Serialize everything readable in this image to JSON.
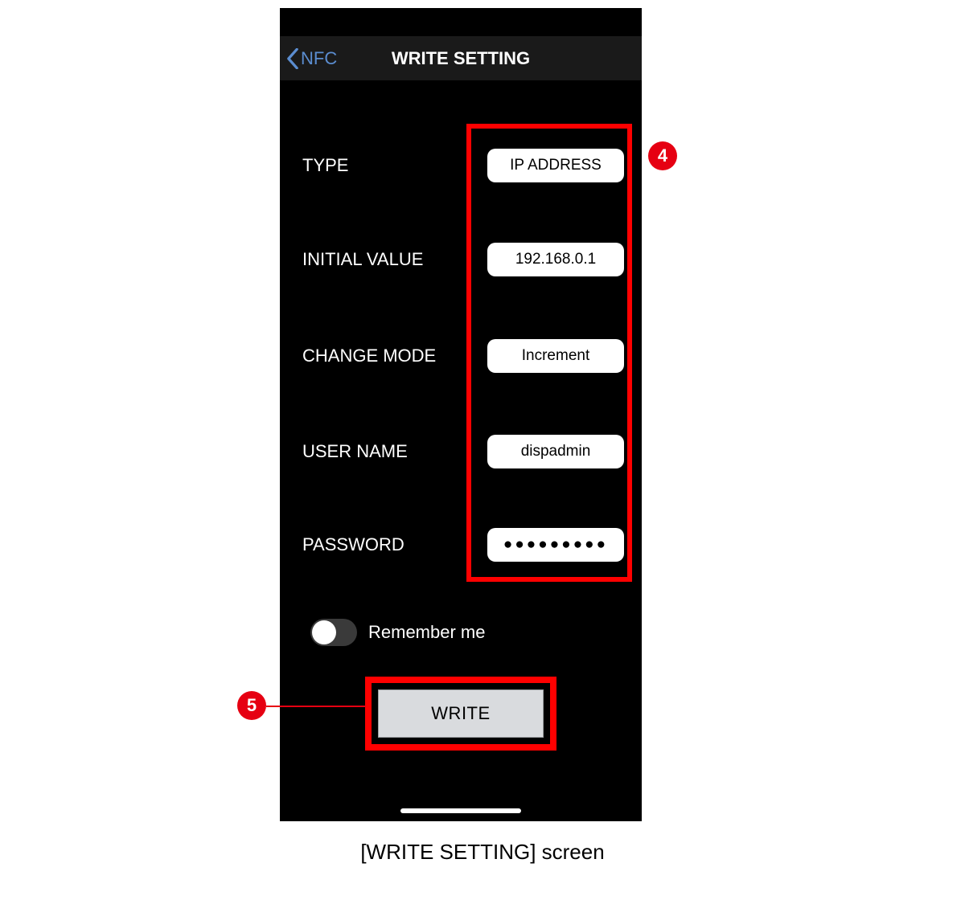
{
  "nav": {
    "back_label": "NFC",
    "title": "WRITE SETTING"
  },
  "fields": {
    "type": {
      "label": "TYPE",
      "value": "IP ADDRESS"
    },
    "initial_value": {
      "label": "INITIAL VALUE",
      "value": "192.168.0.1"
    },
    "change_mode": {
      "label": "CHANGE MODE",
      "value": "Increment"
    },
    "user_name": {
      "label": "USER NAME",
      "value": "dispadmin"
    },
    "password": {
      "label": "PASSWORD",
      "value_masked": "●●●●●●●●●"
    }
  },
  "remember": {
    "label": "Remember me",
    "on": false
  },
  "write_button": {
    "label": "WRITE"
  },
  "callouts": {
    "inputs_badge": "4",
    "write_badge": "5"
  },
  "caption": "[WRITE SETTING] screen"
}
